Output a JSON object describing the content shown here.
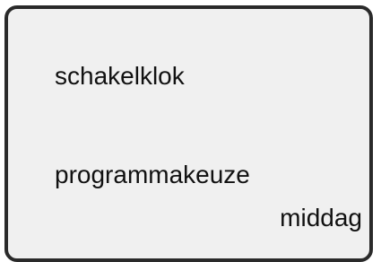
{
  "display": {
    "title": "schakelklok",
    "menu_item": "programmakeuze",
    "selected_value": "middag"
  }
}
